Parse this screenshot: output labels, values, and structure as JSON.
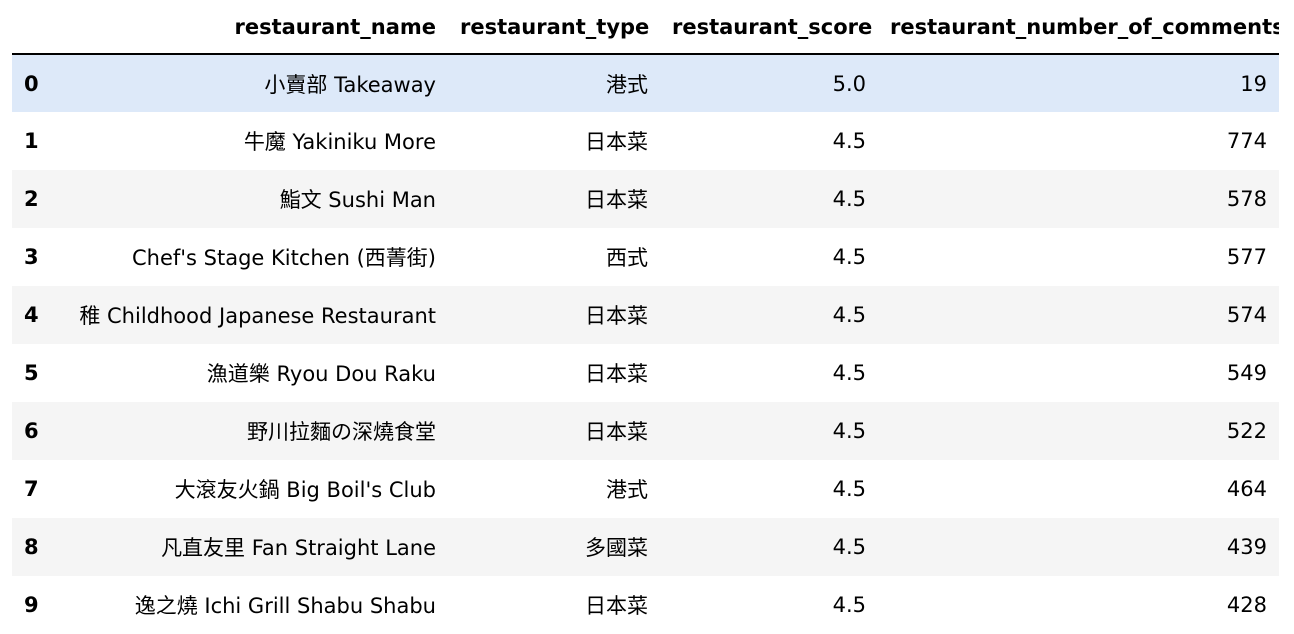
{
  "table": {
    "index_header": "",
    "columns": [
      "restaurant_name",
      "restaurant_type",
      "restaurant_score",
      "restaurant_number_of_comments"
    ],
    "rows": [
      {
        "index": "0",
        "name": "小賣部 Takeaway",
        "type": "港式",
        "score": "5.0",
        "comments": "19"
      },
      {
        "index": "1",
        "name": "牛魔 Yakiniku More",
        "type": "日本菜",
        "score": "4.5",
        "comments": "774"
      },
      {
        "index": "2",
        "name": "鮨文 Sushi Man",
        "type": "日本菜",
        "score": "4.5",
        "comments": "578"
      },
      {
        "index": "3",
        "name": "Chef's Stage Kitchen (西菁街)",
        "type": "西式",
        "score": "4.5",
        "comments": "577"
      },
      {
        "index": "4",
        "name": "稚 Childhood Japanese Restaurant",
        "type": "日本菜",
        "score": "4.5",
        "comments": "574"
      },
      {
        "index": "5",
        "name": "漁道樂 Ryou Dou Raku",
        "type": "日本菜",
        "score": "4.5",
        "comments": "549"
      },
      {
        "index": "6",
        "name": "野川拉麵の深燒食堂",
        "type": "日本菜",
        "score": "4.5",
        "comments": "522"
      },
      {
        "index": "7",
        "name": "大滾友火鍋 Big Boil's Club",
        "type": "港式",
        "score": "4.5",
        "comments": "464"
      },
      {
        "index": "8",
        "name": "凡直友里 Fan Straight Lane",
        "type": "多國菜",
        "score": "4.5",
        "comments": "439"
      },
      {
        "index": "9",
        "name": "逸之燒 Ichi Grill Shabu Shabu",
        "type": "日本菜",
        "score": "4.5",
        "comments": "428"
      }
    ]
  },
  "colors": {
    "selected_row": "#dde9f9",
    "striped_row": "#f5f5f5",
    "header_rule": "#000000"
  }
}
